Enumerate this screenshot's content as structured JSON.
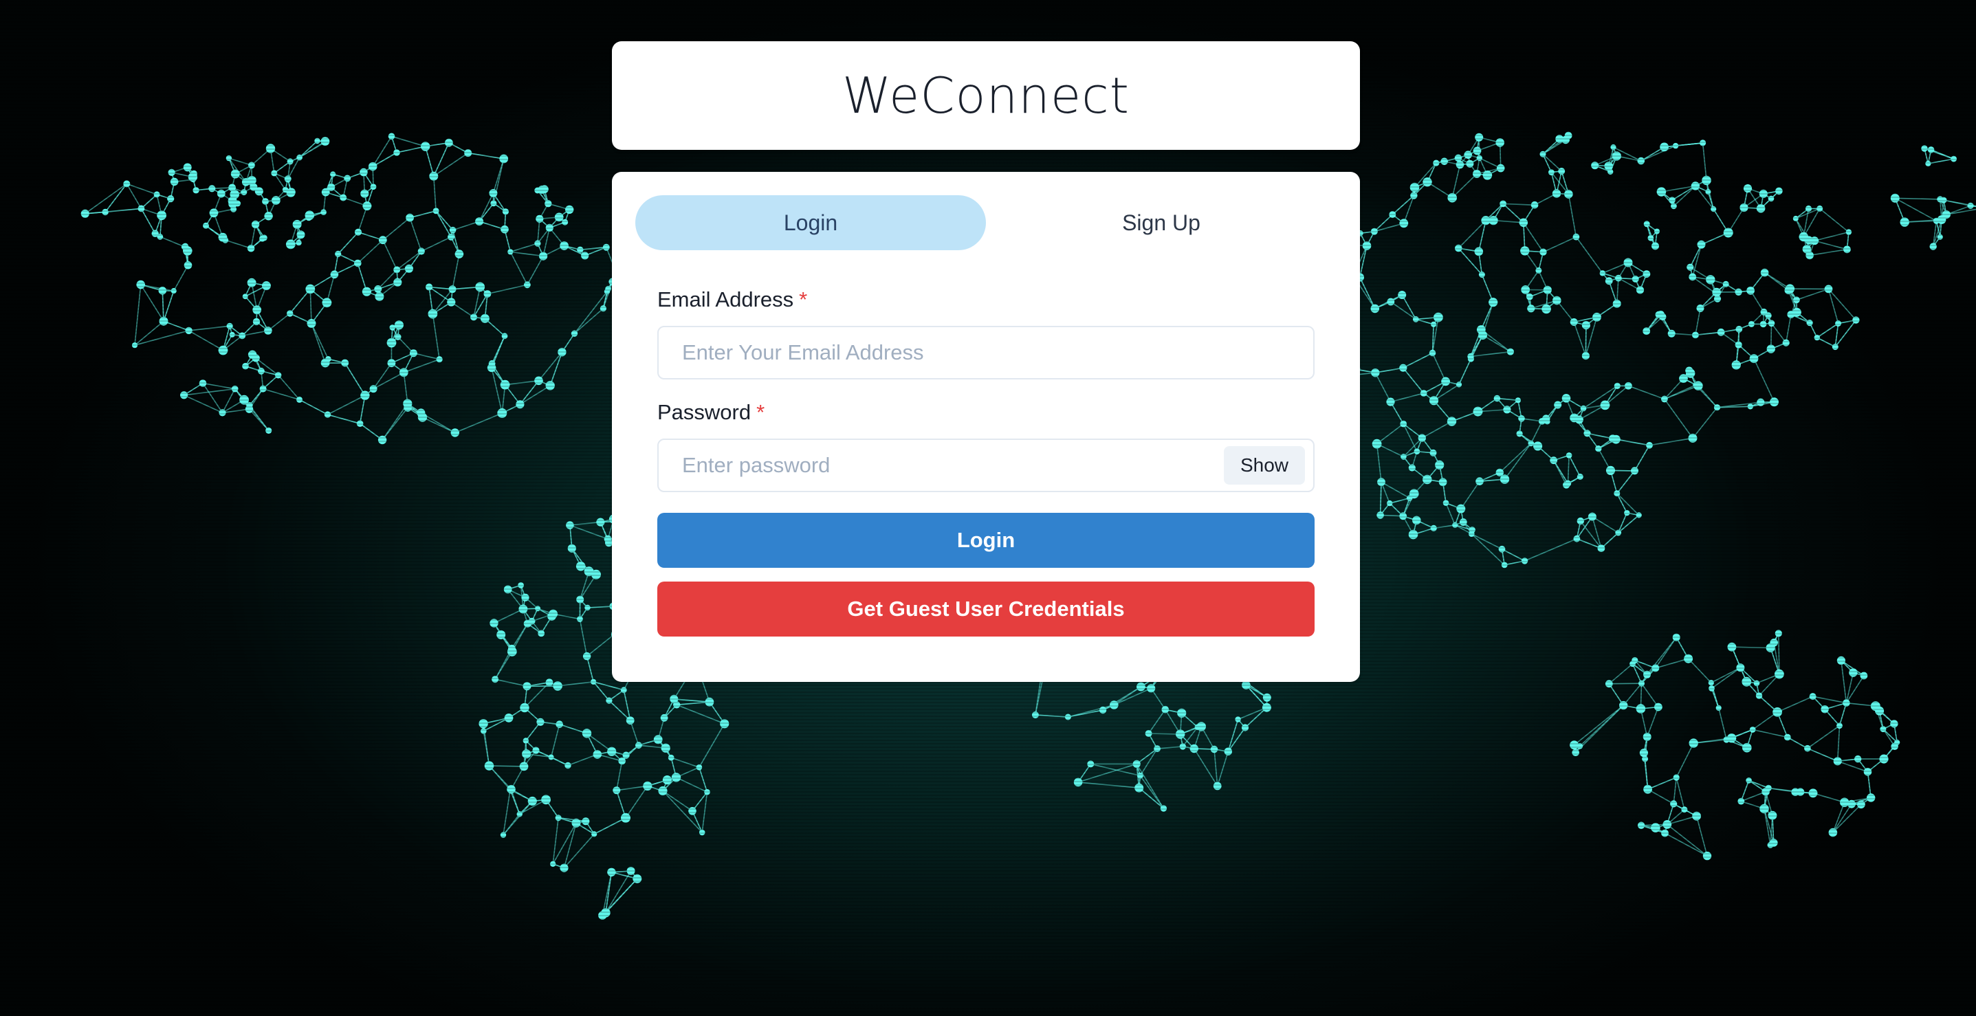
{
  "app": {
    "title": "WeConnect"
  },
  "tabs": [
    {
      "label": "Login",
      "active": true
    },
    {
      "label": "Sign Up",
      "active": false
    }
  ],
  "form": {
    "email": {
      "label": "Email Address",
      "required_mark": "*",
      "placeholder": "Enter Your Email Address",
      "value": ""
    },
    "password": {
      "label": "Password",
      "required_mark": "*",
      "placeholder": "Enter password",
      "value": "",
      "toggle_label": "Show"
    },
    "login_button": "Login",
    "guest_button": "Get Guest User Credentials"
  },
  "colors": {
    "tab_active_bg": "#bee3f8",
    "login_button": "#3182ce",
    "guest_button": "#e53e3e",
    "required_mark": "#e53e3e",
    "network_glow": "#5ff5ea"
  },
  "background": {
    "icon": "world-network-map-icon"
  }
}
